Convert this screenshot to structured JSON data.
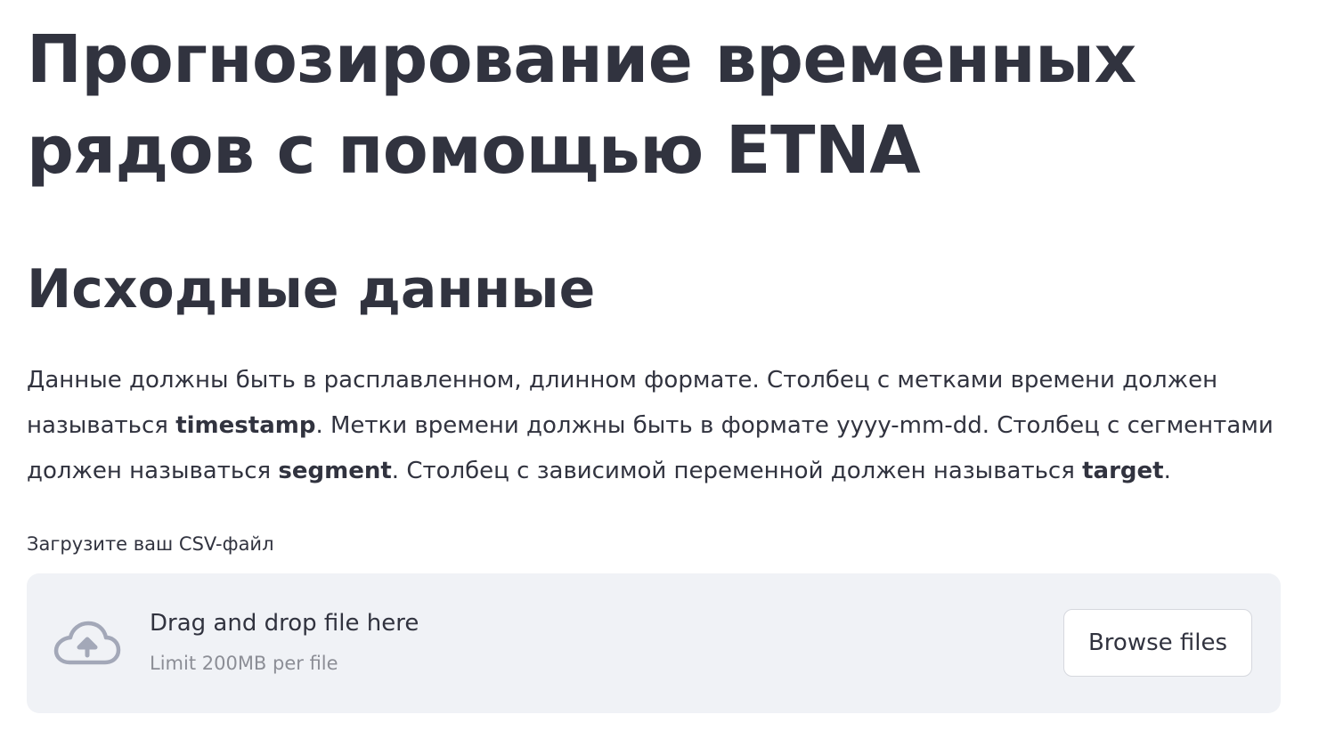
{
  "header": {
    "title": "Прогнозирование временных рядов с помощью ETNA"
  },
  "section": {
    "heading": "Исходные данные",
    "description": {
      "part1": "Данные должны быть в расплавленном, длинном формате. Столбец с метками времени должен называться ",
      "timestamp": "timestamp",
      "part2": ". Метки времени должны быть в формате yyyy-mm-dd. Столбец с сегментами должен называться ",
      "segment": "segment",
      "part3": ". Столбец с зависимой переменной должен называться ",
      "target": "target",
      "part4": "."
    }
  },
  "uploader": {
    "label": "Загрузите ваш CSV-файл",
    "drop_text": "Drag and drop file here",
    "limit_text": "Limit 200MB per file",
    "browse_label": "Browse files",
    "icon": "cloud-upload-icon",
    "icon_color": "#a3a8b8",
    "background": "#f0f2f6"
  }
}
